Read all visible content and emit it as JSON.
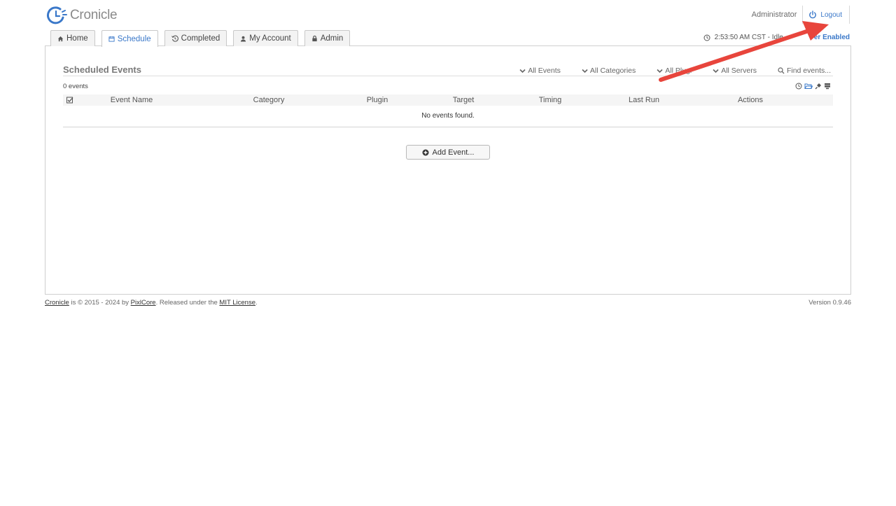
{
  "app": {
    "name": "Cronicle"
  },
  "header": {
    "username": "Administrator",
    "logout_label": "Logout"
  },
  "tabs": [
    {
      "label": "Home",
      "icon": "home-icon"
    },
    {
      "label": "Schedule",
      "icon": "calendar-icon",
      "active": true
    },
    {
      "label": "Completed",
      "icon": "history-icon"
    },
    {
      "label": "My Account",
      "icon": "user-icon"
    },
    {
      "label": "Admin",
      "icon": "lock-icon"
    }
  ],
  "status": {
    "clock": "2:53:50 AM CST - Idle",
    "scheduler_fragment": "er Enabled"
  },
  "schedule": {
    "title": "Scheduled Events",
    "filters": [
      "All Events",
      "All Categories",
      "All Plugi",
      "All Servers"
    ],
    "search_placeholder": "Find events...",
    "count": "0 events",
    "columns": [
      "Event Name",
      "Category",
      "Plugin",
      "Target",
      "Timing",
      "Last Run",
      "Actions"
    ],
    "empty_message": "No events found.",
    "add_button": "Add Event..."
  },
  "footer": {
    "brand": "Cronicle",
    "text_1": " is © 2015 - 2024 by ",
    "author": "PixlCore",
    "text_2": ". Released under the ",
    "license": "MIT License",
    "text_3": ".",
    "version": "Version 0.9.46"
  },
  "colors": {
    "accent": "#3a78c9",
    "annotation_arrow": "#e8453c"
  }
}
